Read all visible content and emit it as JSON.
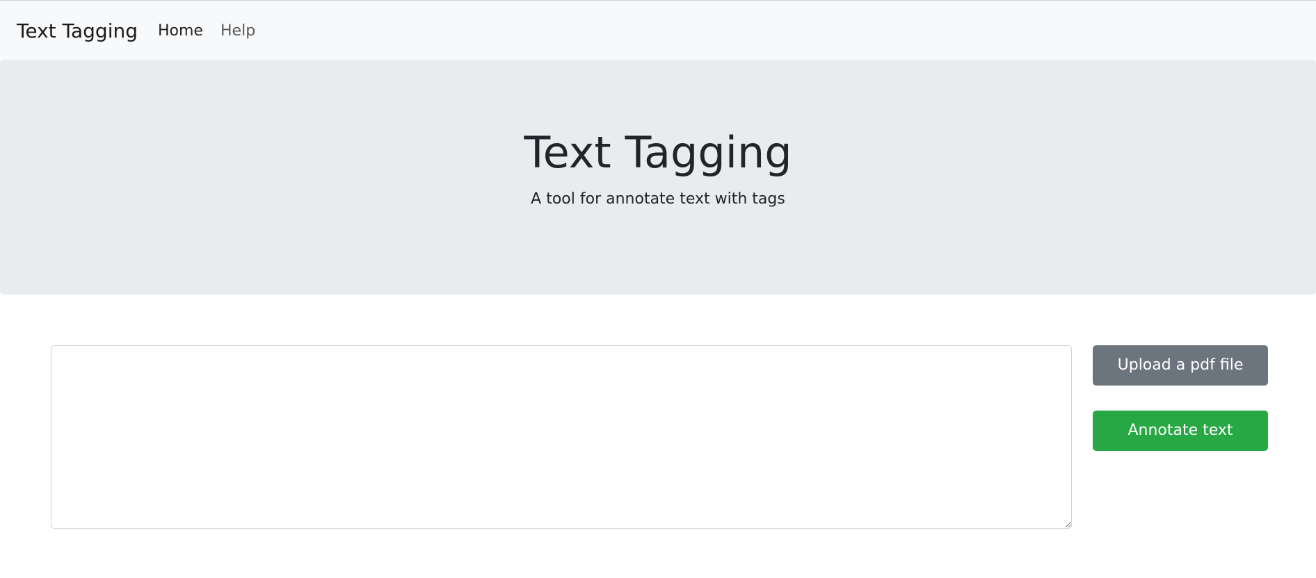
{
  "navbar": {
    "brand": "Text Tagging",
    "links": [
      {
        "label": "Home"
      },
      {
        "label": "Help"
      }
    ]
  },
  "hero": {
    "title": "Text Tagging",
    "subtitle": "A tool for annotate text with tags"
  },
  "editor": {
    "value": "",
    "placeholder": ""
  },
  "actions": {
    "upload_label": "Upload a pdf file",
    "annotate_label": "Annotate text"
  },
  "colors": {
    "navbar_bg": "#f8f9fa",
    "hero_bg": "#e9ecef",
    "upload_button": "#6c757d",
    "annotate_button": "#28a745"
  }
}
